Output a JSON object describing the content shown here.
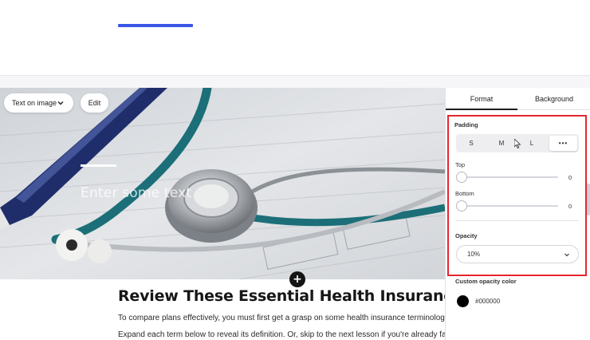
{
  "top_section": {
    "faint_text": "· · · · ·"
  },
  "hero": {
    "placeholder": "Enter some text",
    "type_selector": "Text on image",
    "edit_label": "Edit",
    "add_symbol": "+"
  },
  "article": {
    "heading": "Review These Essential Health Insurance Terms",
    "paragraph_1": "To compare plans effectively, you must first get a grasp on some health insurance terminology.",
    "paragraph_2": "Expand each term below to reveal its definition. Or, skip to the next lesson if you're already familiar."
  },
  "panel": {
    "tabs": {
      "format": "Format",
      "background": "Background"
    },
    "active_tab": "Format",
    "padding": {
      "label": "Padding",
      "options": {
        "s": "S",
        "m": "M",
        "l": "L",
        "more": "•••"
      },
      "selected": "more"
    },
    "top": {
      "label": "Top",
      "value": "0"
    },
    "bottom": {
      "label": "Bottom",
      "value": "0"
    },
    "opacity": {
      "label": "Opacity",
      "value": "10%"
    },
    "custom_color": {
      "label": "Custom opacity color",
      "hex": "#000000"
    }
  },
  "colors": {
    "accent": "#3a57e8",
    "highlight_box": "#e5262d",
    "swatch": "#000000"
  }
}
